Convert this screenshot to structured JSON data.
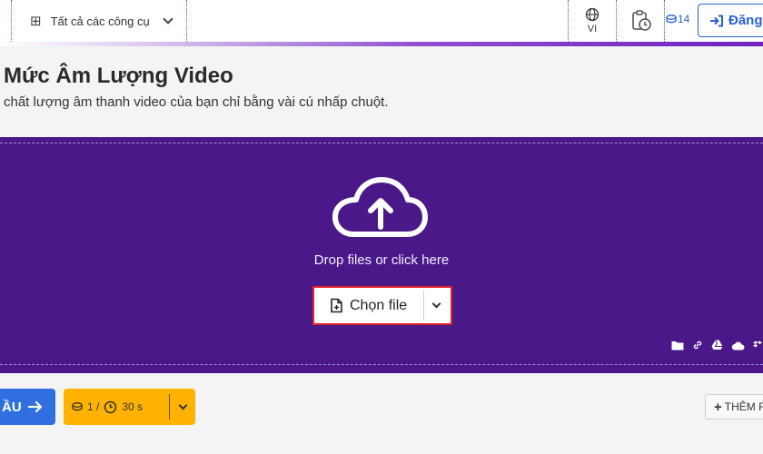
{
  "header": {
    "tools_menu_label": "Tất cả các công cụ",
    "language_code": "VI",
    "credits_count": "14",
    "login_label": "Đăng"
  },
  "page": {
    "title": "Mức Âm Lượng Video",
    "subtitle": "chất lượng âm thanh video của bạn chỉ bằng vài cú nhấp chuột."
  },
  "dropzone": {
    "prompt": "Drop files or click here",
    "choose_label": "Chọn file",
    "sources": [
      "folder-icon",
      "link-icon",
      "google-drive-icon",
      "cloud-icon",
      "dropbox-icon"
    ],
    "background_color": "#4a1889"
  },
  "actions": {
    "start_label": "ẦU",
    "quota_files": "1 /",
    "quota_time": "30 s",
    "add_more_label": "THÊM F"
  },
  "colors": {
    "accent_blue": "#2f6fe0",
    "quota_yellow": "#ffb300",
    "highlight_red": "#e0212b"
  }
}
